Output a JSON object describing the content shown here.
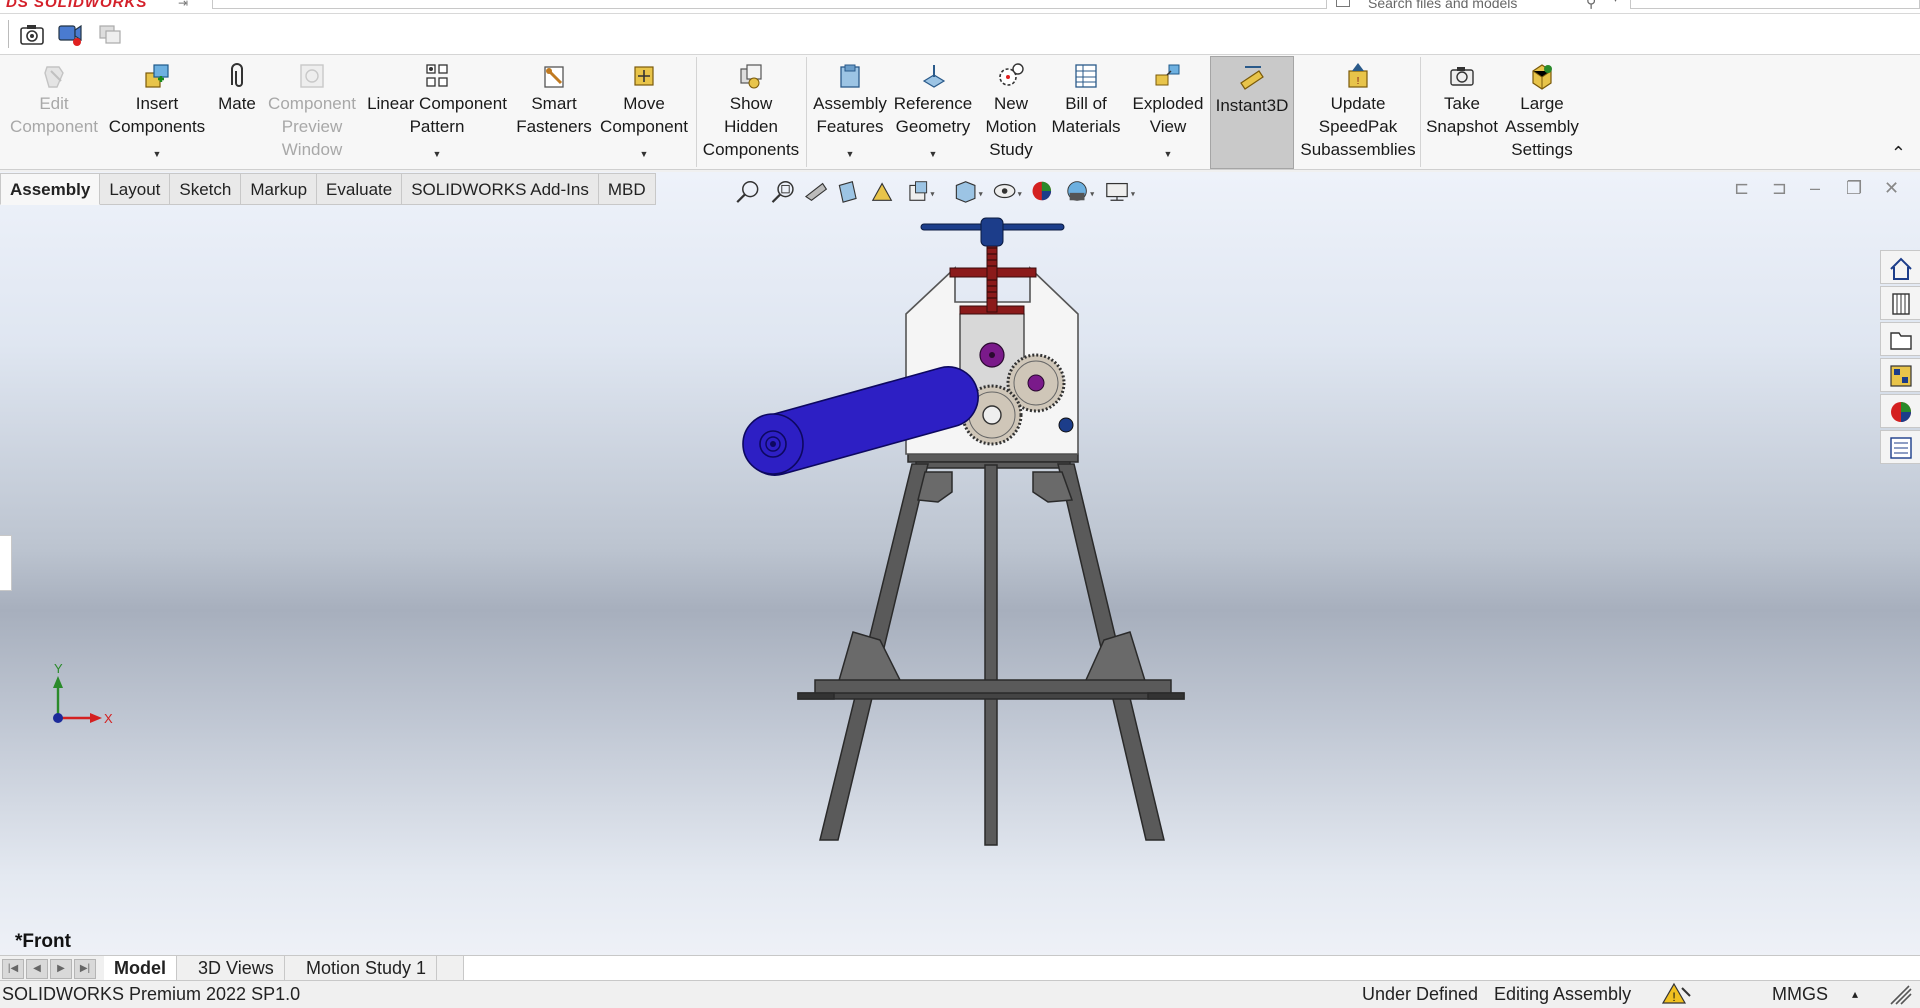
{
  "app": {
    "logo": "DS SOLIDWORKS",
    "search_placeholder": "Search files and models"
  },
  "ribbon": {
    "buttons": [
      {
        "id": "edit-component",
        "label": "Edit\nComponent",
        "icon": "edit-component-icon",
        "enabled": false,
        "has_dropdown": false
      },
      {
        "id": "insert-components",
        "label": "Insert\nComponents",
        "icon": "insert-components-icon",
        "enabled": true,
        "has_dropdown": true
      },
      {
        "id": "mate",
        "label": "Mate",
        "icon": "paperclip-icon",
        "enabled": true,
        "has_dropdown": false
      },
      {
        "id": "component-preview-window",
        "label": "Component\nPreview\nWindow",
        "icon": "preview-window-icon",
        "enabled": false,
        "has_dropdown": false
      },
      {
        "id": "linear-component-pattern",
        "label": "Linear Component\nPattern",
        "icon": "linear-pattern-icon",
        "enabled": true,
        "has_dropdown": true
      },
      {
        "id": "smart-fasteners",
        "label": "Smart\nFasteners",
        "icon": "smart-fasteners-icon",
        "enabled": true,
        "has_dropdown": false
      },
      {
        "id": "move-component",
        "label": "Move\nComponent",
        "icon": "move-component-icon",
        "enabled": true,
        "has_dropdown": true
      },
      {
        "id": "show-hidden-components",
        "label": "Show\nHidden\nComponents",
        "icon": "show-hidden-icon",
        "enabled": true,
        "has_dropdown": false
      },
      {
        "id": "assembly-features",
        "label": "Assembly\nFeatures",
        "icon": "assembly-features-icon",
        "enabled": true,
        "has_dropdown": true
      },
      {
        "id": "reference-geometry",
        "label": "Reference\nGeometry",
        "icon": "reference-geometry-icon",
        "enabled": true,
        "has_dropdown": true
      },
      {
        "id": "new-motion-study",
        "label": "New\nMotion\nStudy",
        "icon": "motion-study-icon",
        "enabled": true,
        "has_dropdown": false
      },
      {
        "id": "bill-of-materials",
        "label": "Bill of\nMaterials",
        "icon": "bill-of-materials-icon",
        "enabled": true,
        "has_dropdown": false
      },
      {
        "id": "exploded-view",
        "label": "Exploded\nView",
        "icon": "exploded-view-icon",
        "enabled": true,
        "has_dropdown": true
      },
      {
        "id": "instant3d",
        "label": "Instant3D",
        "icon": "instant3d-icon",
        "enabled": true,
        "has_dropdown": false,
        "active": true
      },
      {
        "id": "update-speedpak",
        "label": "Update\nSpeedPak\nSubassemblies",
        "icon": "speedpak-icon",
        "enabled": true,
        "has_dropdown": false
      },
      {
        "id": "take-snapshot",
        "label": "Take\nSnapshot",
        "icon": "camera-icon",
        "enabled": true,
        "has_dropdown": false
      },
      {
        "id": "large-assembly-settings",
        "label": "Large\nAssembly\nSettings",
        "icon": "large-assembly-icon",
        "enabled": true,
        "has_dropdown": false
      }
    ]
  },
  "command_tabs": [
    "Assembly",
    "Layout",
    "Sketch",
    "Markup",
    "Evaluate",
    "SOLIDWORKS Add-Ins",
    "MBD"
  ],
  "active_command_tab": "Assembly",
  "heads_up_toolbar": [
    "zoom-to-fit-icon",
    "zoom-to-area-icon",
    "previous-view-icon",
    "section-view-icon",
    "dynamic-annotation-icon",
    "view-orientation-icon",
    "display-style-icon",
    "hide-show-items-icon",
    "edit-appearance-icon",
    "apply-scene-icon",
    "view-settings-icon"
  ],
  "task_pane": [
    "home-icon",
    "design-library-icon",
    "file-explorer-icon",
    "view-palette-icon",
    "appearances-icon",
    "custom-properties-icon"
  ],
  "viewport": {
    "view_name": "*Front",
    "triad": {
      "x": "X",
      "y": "Y"
    }
  },
  "bottom_tabs": [
    "Model",
    "3D Views",
    "Motion Study 1"
  ],
  "active_bottom_tab": "Model",
  "status": {
    "product": "SOLIDWORKS Premium 2022 SP1.0",
    "definition": "Under Defined",
    "mode": "Editing Assembly",
    "units": "MMGS"
  },
  "colors": {
    "viewport_top": "#eef2fa",
    "viewport_mid": "#a7afbd",
    "handle_blue": "#2d1fc4",
    "frame_dark": "#555555",
    "screw_red": "#8b1a1a",
    "pin_purple": "#7a1a8a",
    "gear": "#cfc6b8",
    "tbar_blue": "#1c3d8a"
  }
}
